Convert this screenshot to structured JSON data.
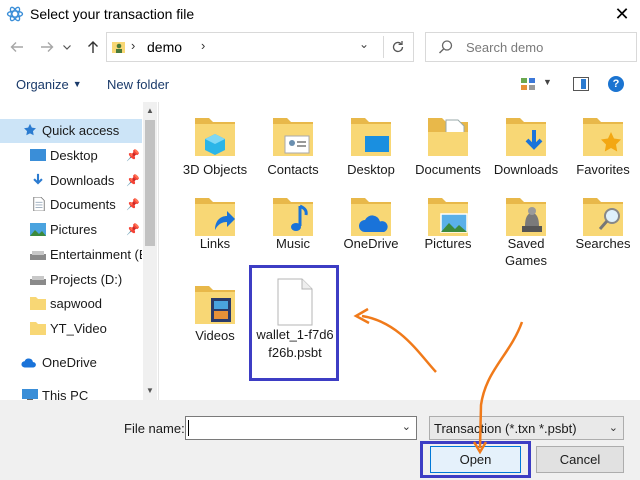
{
  "window": {
    "title": "Select your transaction file",
    "close_glyph": "✕"
  },
  "nav": {
    "back_icon": "back-arrow-icon",
    "forward_icon": "forward-arrow-icon",
    "recent_icon": "chevron-down-icon",
    "up_icon": "up-arrow-icon",
    "address_path": "demo",
    "refresh_icon": "refresh-icon",
    "search_placeholder": "Search demo"
  },
  "toolbar": {
    "organize_label": "Organize",
    "new_folder_label": "New folder",
    "help_label": "?"
  },
  "sidebar": {
    "items": [
      {
        "label": "Quick access",
        "icon": "star-icon",
        "pinned": false,
        "selected": true
      },
      {
        "label": "Desktop",
        "icon": "desktop-icon",
        "pinned": true
      },
      {
        "label": "Downloads",
        "icon": "download-icon",
        "pinned": true
      },
      {
        "label": "Documents",
        "icon": "documents-icon",
        "pinned": true
      },
      {
        "label": "Pictures",
        "icon": "pictures-icon",
        "pinned": true
      },
      {
        "label": "Entertainment (E:",
        "icon": "drive-icon",
        "pinned": false
      },
      {
        "label": "Projects (D:)",
        "icon": "drive-icon",
        "pinned": false
      },
      {
        "label": "sapwood",
        "icon": "folder-icon",
        "pinned": false
      },
      {
        "label": "YT_Video",
        "icon": "folder-icon",
        "pinned": false
      },
      {
        "label": "OneDrive",
        "icon": "cloud-icon",
        "pinned": false
      },
      {
        "label": "This PC",
        "icon": "pc-icon",
        "pinned": false
      }
    ]
  },
  "folders": [
    {
      "label": "3D Objects",
      "icon": "3d-objects-icon"
    },
    {
      "label": "Contacts",
      "icon": "contacts-icon"
    },
    {
      "label": "Desktop",
      "icon": "desktop-folder-icon"
    },
    {
      "label": "Documents",
      "icon": "documents-folder-icon"
    },
    {
      "label": "Downloads",
      "icon": "downloads-folder-icon"
    },
    {
      "label": "Favorites",
      "icon": "favorites-folder-icon"
    },
    {
      "label": "Links",
      "icon": "links-folder-icon"
    },
    {
      "label": "Music",
      "icon": "music-folder-icon"
    },
    {
      "label": "OneDrive",
      "icon": "onedrive-folder-icon"
    },
    {
      "label": "Pictures",
      "icon": "pictures-folder-icon"
    },
    {
      "label": "Saved\nGames",
      "icon": "saved-games-folder-icon"
    },
    {
      "label": "Searches",
      "icon": "searches-folder-icon"
    },
    {
      "label": "Videos",
      "icon": "videos-folder-icon"
    }
  ],
  "file": {
    "label": "wallet_1-f7d6f26b.psbt",
    "icon": "document-file-icon"
  },
  "bottom": {
    "filename_label": "File name:",
    "filename_value": "",
    "filter_label": "Transaction (*.txn *.psbt)",
    "open_label": "Open",
    "cancel_label": "Cancel"
  },
  "colors": {
    "highlight_box": "#3d3dc4",
    "arrow": "#f07a1a",
    "selection": "#cce4f7",
    "folder_yellow": "#f8d775"
  }
}
